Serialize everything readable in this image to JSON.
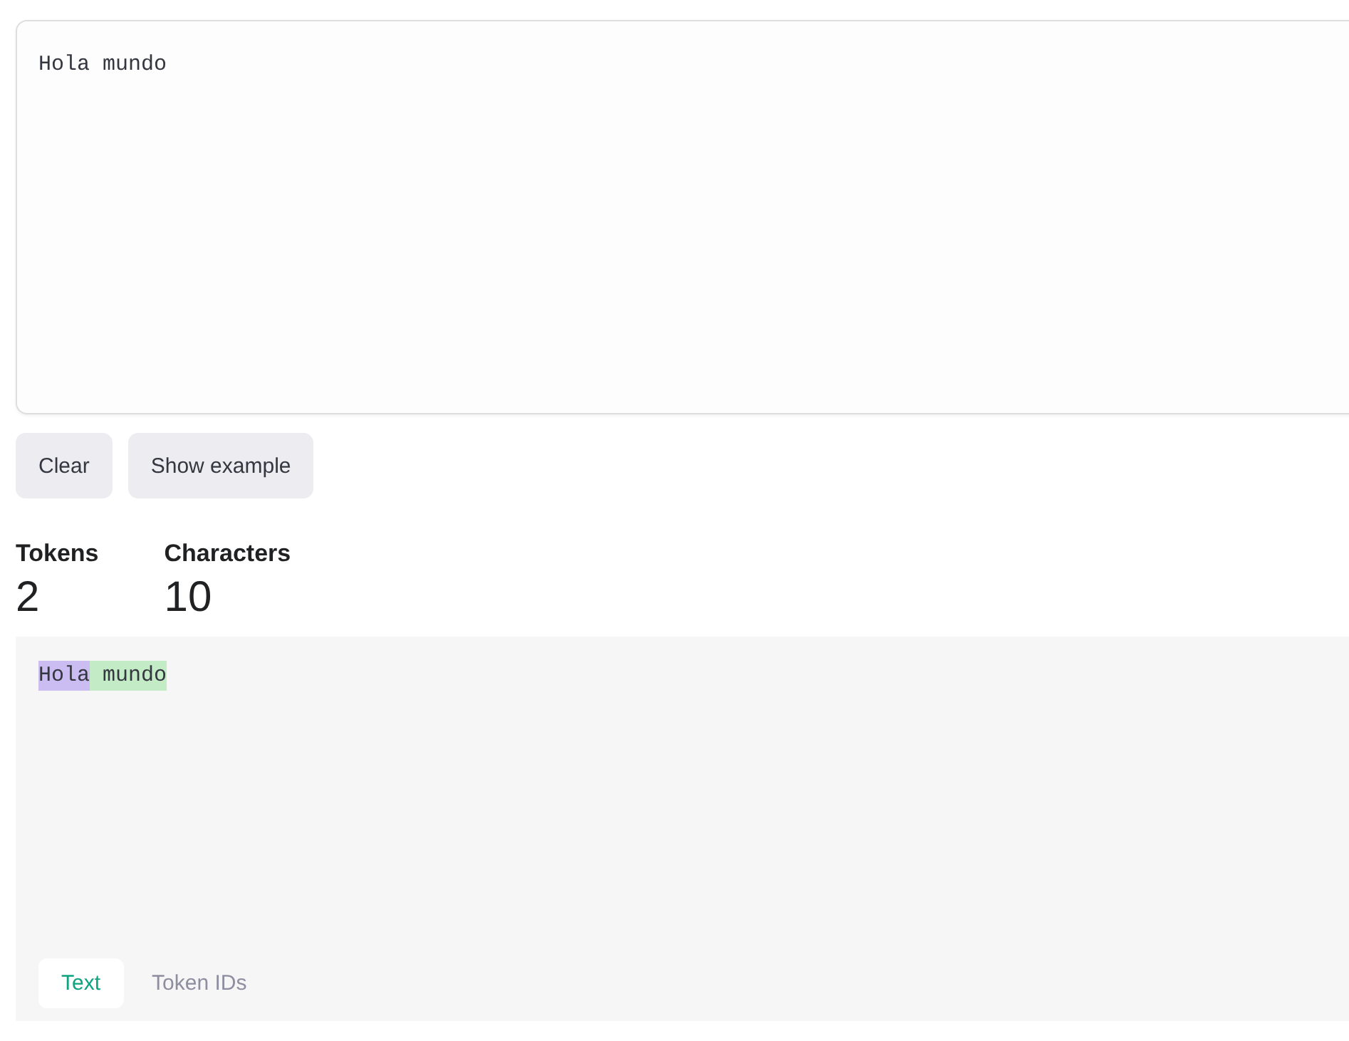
{
  "input": {
    "value": "Hola mundo"
  },
  "buttons": [
    "Clear",
    "Show example"
  ],
  "stats": [
    {
      "label": "Tokens",
      "value": "2"
    },
    {
      "label": "Characters",
      "value": "10"
    }
  ],
  "tokens": [
    {
      "text": "Hola",
      "color": "#cbbcf2"
    },
    {
      "text": " mundo",
      "color": "#c3ecc6"
    }
  ],
  "tabs": [
    {
      "label": "Text",
      "selected": true
    },
    {
      "label": "Token IDs",
      "selected": false
    }
  ]
}
